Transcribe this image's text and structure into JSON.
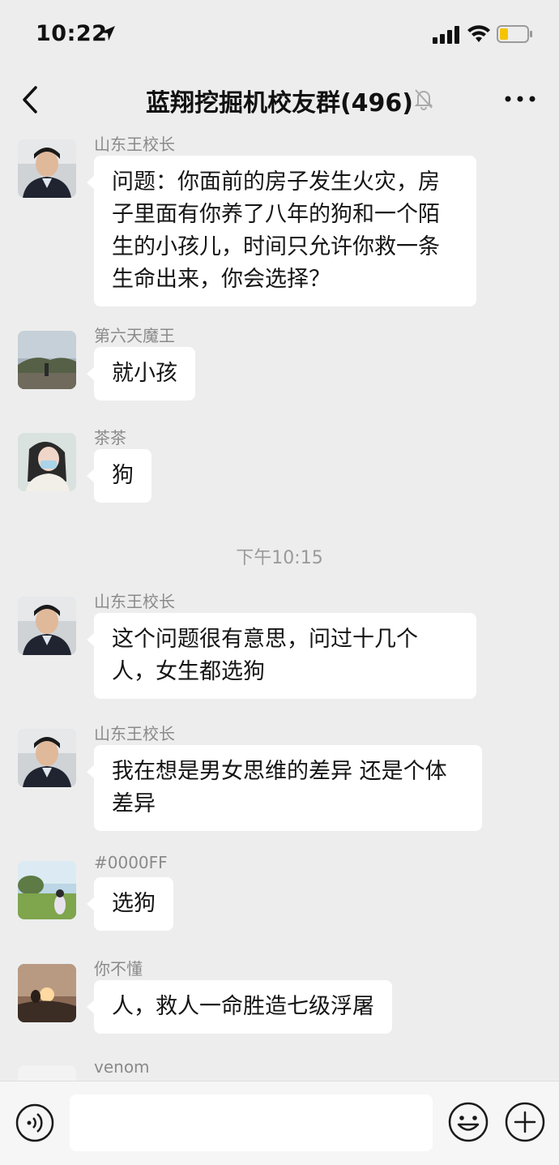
{
  "status_bar": {
    "time": "10:22",
    "icons": [
      "location-arrow-icon",
      "signal-icon",
      "wifi-icon",
      "battery-low-icon"
    ]
  },
  "nav": {
    "title": "蓝翔挖掘机校友群(496)",
    "icons": [
      "back-chevron-icon",
      "mute-bell-icon",
      "more-dots-icon"
    ]
  },
  "messages": [
    {
      "sender": "山东王校长",
      "text": "问题：你面前的房子发生火灾，房子里面有你养了八年的狗和一个陌生的小孩儿，时间只允许你救一条生命出来，你会选择？"
    },
    {
      "sender": "第六天魔王",
      "text": "就小孩"
    },
    {
      "sender": "茶茶",
      "text": "狗"
    },
    {
      "timestamp": "下午10:15"
    },
    {
      "sender": "山东王校长",
      "text": "这个问题很有意思，问过十几个人，女生都选狗"
    },
    {
      "sender": "山东王校长",
      "text": "我在想是男女思维的差异 还是个体差异"
    },
    {
      "sender": "#0000FF",
      "text": "选狗"
    },
    {
      "sender": "你不懂",
      "text": "人，救人一命胜造七级浮屠"
    },
    {
      "sender": "venom",
      "text": ""
    }
  ],
  "input_bar": {
    "placeholder": "",
    "icons": [
      "voice-icon",
      "emoji-icon",
      "plus-icon"
    ]
  },
  "colors": {
    "background": "#ededed",
    "bubble": "#ffffff",
    "sender_name": "#8a8a8a",
    "timestamp": "#9a9a9a"
  }
}
